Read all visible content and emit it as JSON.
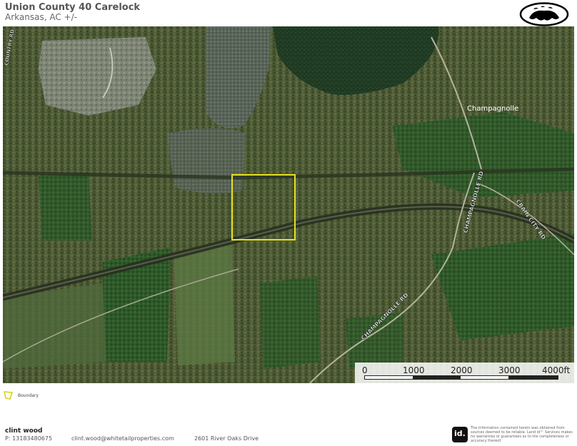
{
  "header": {
    "title": "Union County 40 Carelock",
    "subtitle": "Arkansas,  AC +/-"
  },
  "map": {
    "labels": {
      "place": "Champagnolle",
      "road_champagnolle_upper": "CHAMPAGNOLLE RD",
      "road_champagnolle_lower": "CHAMPAGNOLLE RD",
      "road_crain_city": "CRAIN CITY RD",
      "road_country": "COUNTRY RD"
    },
    "boundary_color": "#e6e020",
    "scale": {
      "labels": [
        "0",
        "1000",
        "2000",
        "3000",
        "4000ft"
      ]
    }
  },
  "legend": {
    "label": "Boundary"
  },
  "footer": {
    "name": "clint wood",
    "phone": "P: 13183480675",
    "email": "clint.wood@whitetailproperties.com",
    "address": "2601 River Oaks Drive",
    "disclaimer_logo": "id.",
    "disclaimer": "The information contained herein was obtained from sources deemed to be reliable. Land id™ Services makes no warranties or guarantees as to the completeness or accuracy thereof."
  }
}
